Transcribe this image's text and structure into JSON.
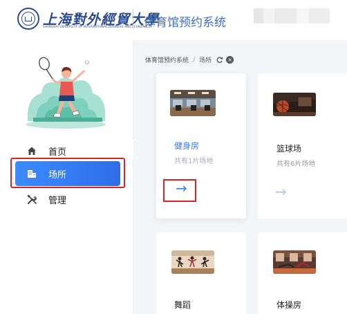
{
  "header": {
    "university_name": "上海對外經貿大學",
    "university_subtitle": "SHANGHAI UNIVERSITY OF INTERNATIONAL BUSINESS AND ECONOMICS",
    "system_title": "体育馆预约系统"
  },
  "sidebar": {
    "items": [
      {
        "label": "首页",
        "icon": "home-icon",
        "active": false
      },
      {
        "label": "场所",
        "icon": "building-icon",
        "active": true
      },
      {
        "label": "管理",
        "icon": "tools-icon",
        "active": false
      }
    ],
    "collapse_icon": "double-chevron-left-icon"
  },
  "breadcrumb": {
    "items": [
      "体育馆预约系统",
      "场所"
    ],
    "separator": "/"
  },
  "venues": [
    {
      "name": "健身房",
      "count": "共有1片场地",
      "arrow": "→"
    },
    {
      "name": "篮球场",
      "count": "共有6片场地",
      "arrow": "→"
    },
    {
      "name": "舞蹈",
      "count": "",
      "arrow": ""
    },
    {
      "name": "体操房",
      "count": "",
      "arrow": ""
    }
  ],
  "colors": {
    "primary": "#3b82f0",
    "active_nav_start": "#3b8bff",
    "active_nav_end": "#2f6de8",
    "highlight_outline": "#e02020",
    "brand_navy": "#2b4a8f"
  }
}
